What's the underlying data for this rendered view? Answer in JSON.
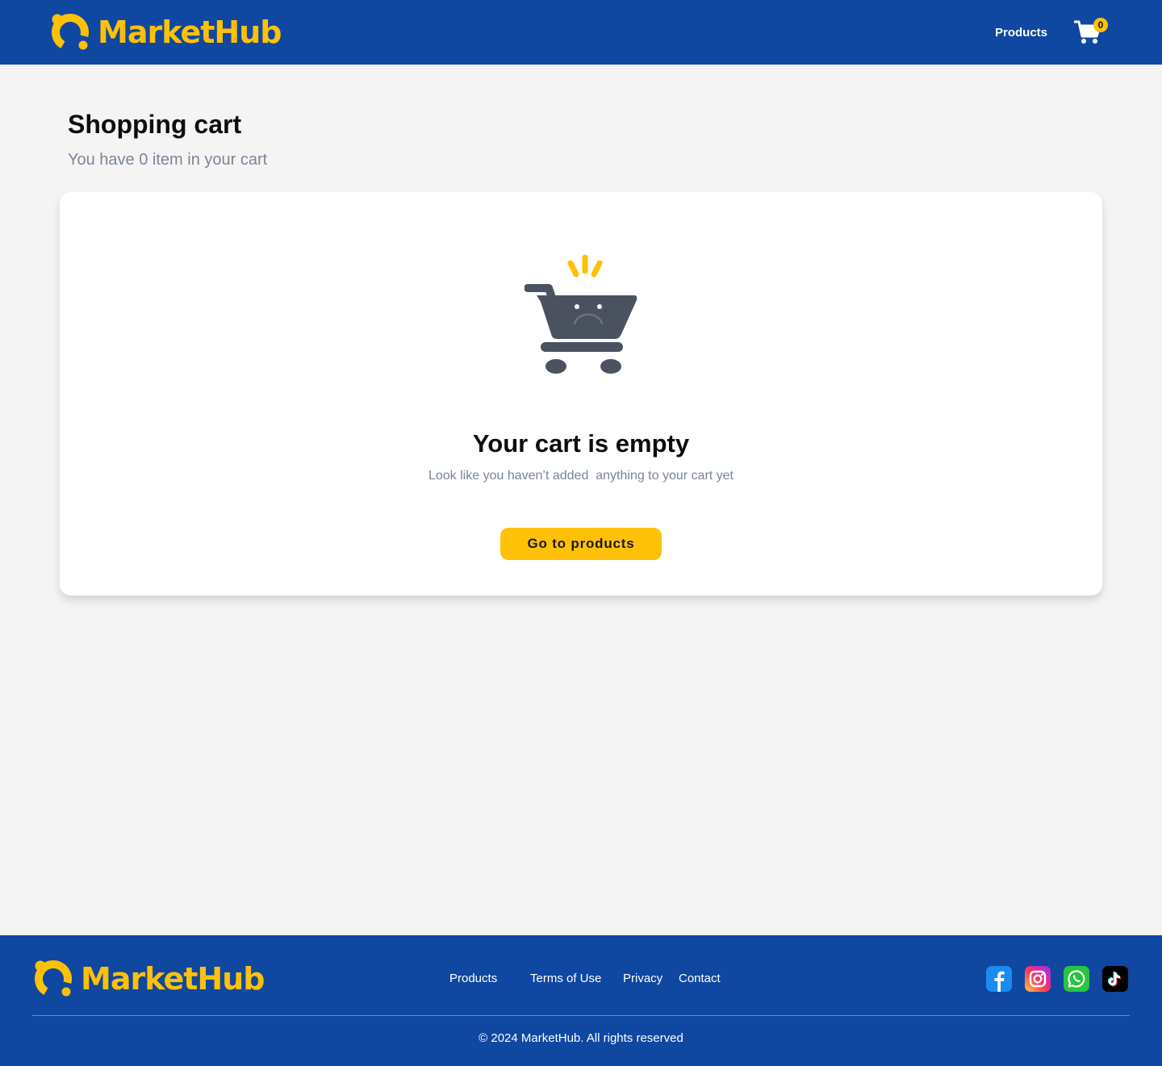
{
  "brand": {
    "name": "MarketHub",
    "accent": "#ffc107",
    "primary": "#0f47a1"
  },
  "header": {
    "nav_products": "Products",
    "cart_count": "0",
    "cart_icon": "cart-icon"
  },
  "main": {
    "title": "Shopping cart",
    "subtitle": "You have 0 item in your cart",
    "empty_state": {
      "icon": "sad-cart-icon",
      "title": "Your cart is empty",
      "description": "Look like you haven’t added  anything to your cart yet",
      "button_label": "Go to products"
    }
  },
  "footer": {
    "links": [
      "Products",
      "Terms of Use",
      "Privacy",
      "Contact"
    ],
    "socials": [
      "facebook-icon",
      "instagram-icon",
      "whatsapp-icon",
      "tiktok-icon"
    ],
    "copyright": "© 2024 MarketHub. All rights reserved"
  }
}
